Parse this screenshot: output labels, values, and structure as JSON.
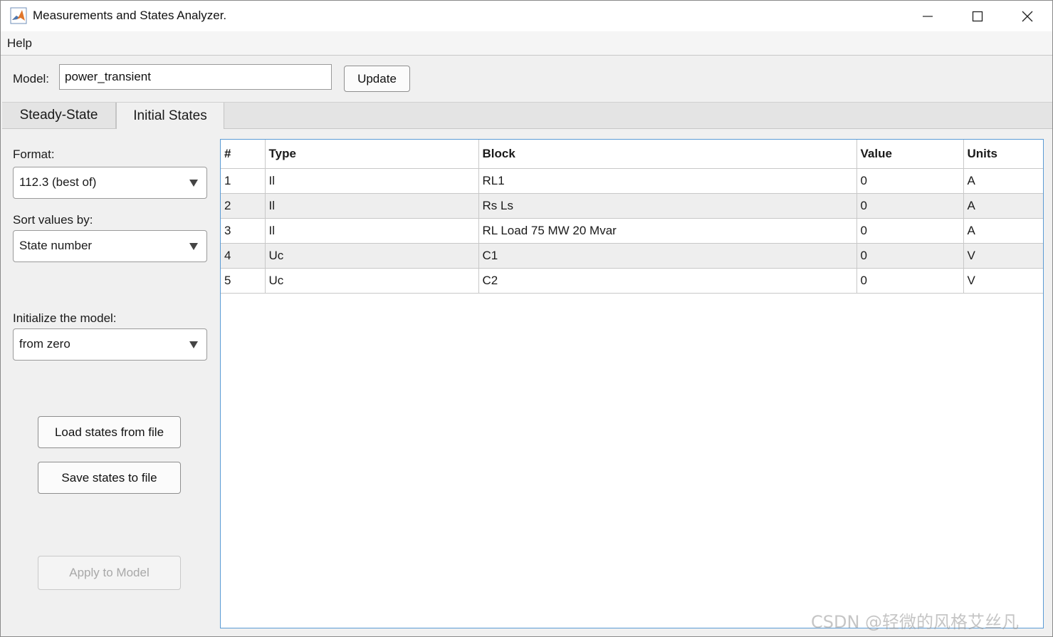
{
  "window": {
    "title": "Measurements and States Analyzer."
  },
  "menu": [
    "Help"
  ],
  "model": {
    "label": "Model:",
    "value": "power_transient",
    "update_label": "Update"
  },
  "tabs": [
    {
      "label": "Steady-State",
      "selected": false
    },
    {
      "label": "Initial States",
      "selected": true
    }
  ],
  "left_panel": {
    "format_label": "Format:",
    "format_value": "112.3 (best of)",
    "sort_label": "Sort values by:",
    "sort_value": "State number",
    "init_label": "Initialize the model:",
    "init_value": "from zero",
    "load_button": "Load states from file",
    "save_button": "Save states to file",
    "apply_button": "Apply to Model"
  },
  "table": {
    "headers": [
      "#",
      "Type",
      "Block",
      "Value",
      "Units"
    ],
    "rows": [
      [
        "1",
        "Il",
        "RL1",
        "0",
        "A"
      ],
      [
        "2",
        "Il",
        "Rs Ls",
        "0",
        "A"
      ],
      [
        "3",
        "Il",
        "RL Load 75 MW 20 Mvar",
        "0",
        "A"
      ],
      [
        "4",
        "Uc",
        "C1",
        "0",
        "V"
      ],
      [
        "5",
        "Uc",
        "C2",
        "0",
        "V"
      ]
    ]
  },
  "watermark": "CSDN @轻微的风格艾丝凡",
  "colors": {
    "table_border": "#5b9bd5",
    "disabled_text": "#a8a8a8"
  },
  "icons": [
    "matlab-app-icon",
    "minimize-icon",
    "maximize-icon",
    "close-icon",
    "dropdown-arrow-icon"
  ]
}
